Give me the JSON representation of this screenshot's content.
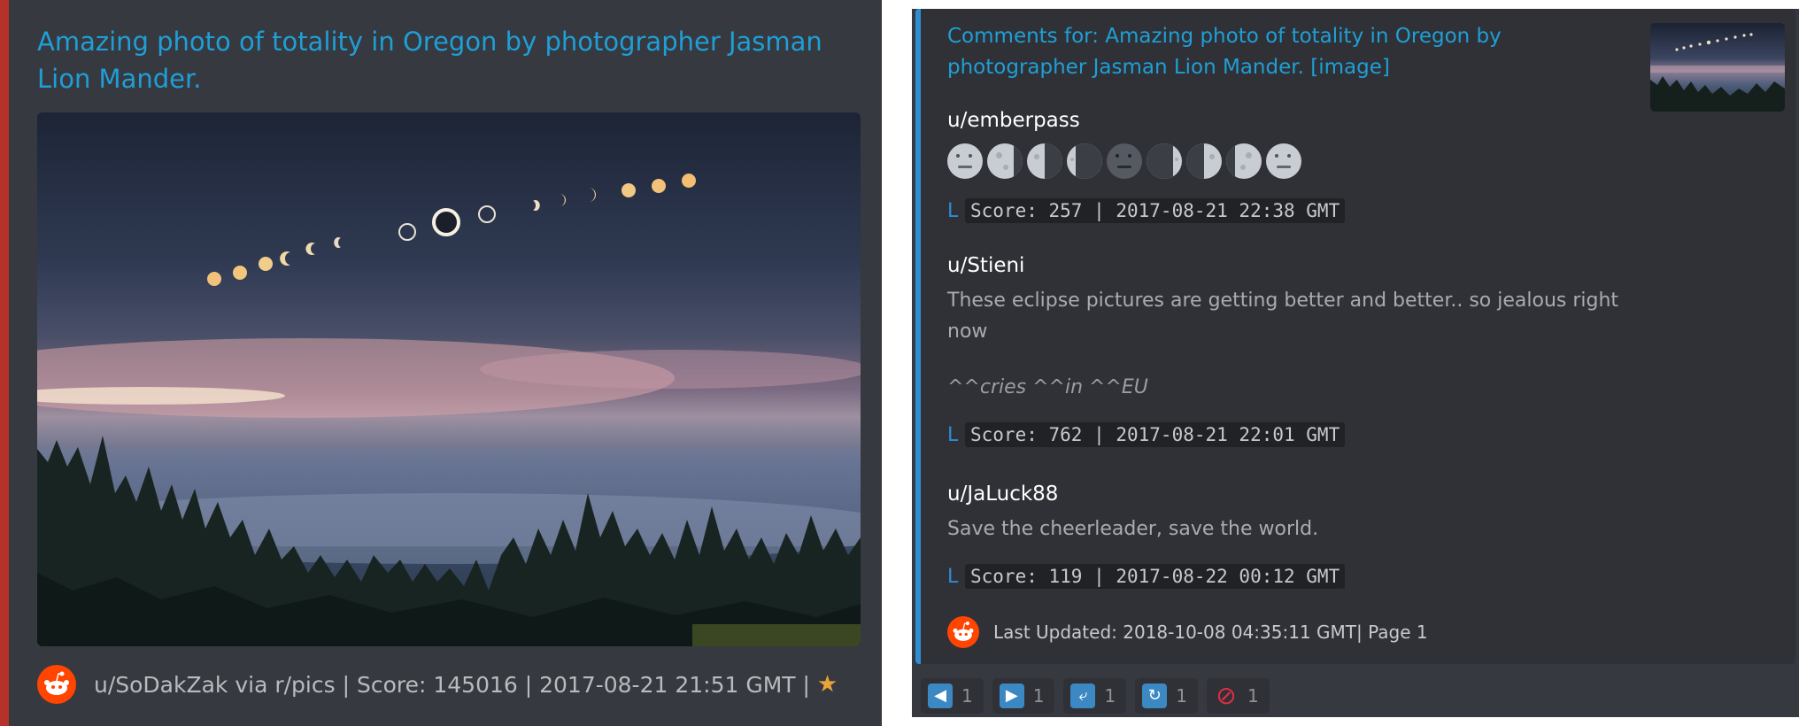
{
  "colors": {
    "left_accent": "#b5312a",
    "right_accent": "#2f8ed3",
    "link": "#1f9fd6",
    "reddit_orange": "#ff4500",
    "star": "#e8a33a"
  },
  "left": {
    "title": "Amazing photo of totality in Oregon by photographer Jasman Lion Mander.",
    "image_icon": "eclipse-photo",
    "footer": "u/SoDakZak via r/pics | Score: 145016 | 2017-08-21 21:51 GMT |",
    "footer_icon": "star-icon"
  },
  "right": {
    "title": "Comments for: Amazing photo of totality in Oregon by photographer Jasman Lion Mander. [image]",
    "comments": [
      {
        "author": "u/emberpass",
        "moons": [
          "full",
          "waning-gibbous",
          "last-quarter",
          "waning-crescent",
          "new",
          "waxing-crescent",
          "first-quarter",
          "waxing-gibbous",
          "full"
        ],
        "score_mark": "L",
        "score": "Score: 257 | 2017-08-21 22:38 GMT"
      },
      {
        "author": "u/Stieni",
        "body": "These eclipse pictures are getting better and better.. so jealous right now",
        "body_extra": "^^cries ^^in ^^EU",
        "score_mark": "L",
        "score": "Score: 762 | 2017-08-21 22:01 GMT"
      },
      {
        "author": "u/JaLuck88",
        "body": "Save the cheerleader, save the world.",
        "score_mark": "L",
        "score": "Score: 119 | 2017-08-22 00:12 GMT"
      }
    ],
    "updated": "Last Updated: 2018-10-08 04:35:11 GMT| Page 1",
    "reactions": [
      {
        "icon": "arrow-left-icon",
        "glyph": "◀",
        "count": "1"
      },
      {
        "icon": "arrow-right-icon",
        "glyph": "▶",
        "count": "1"
      },
      {
        "icon": "return-icon",
        "glyph": "⤶",
        "count": "1"
      },
      {
        "icon": "refresh-icon",
        "glyph": "↻",
        "count": "1"
      },
      {
        "icon": "prohibited-icon",
        "glyph": "⊘",
        "count": "1"
      }
    ]
  }
}
